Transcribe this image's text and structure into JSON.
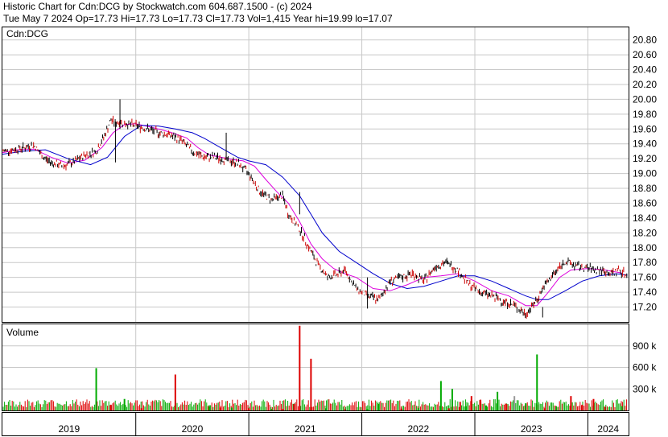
{
  "header": {
    "line1": "Historic Chart for Cdn:DCG by Stockwatch.com 604.687.1500 - (c) 2024",
    "line2": "Tue May  7 2024   Op=17.73  Hi=17.73  Lo=17.73  Cl=17.73  Vol=1,415   Year hi=19.99  lo=17.07"
  },
  "chart_data": [
    {
      "type": "line",
      "panel": "price",
      "panel_label": "Cdn:DCG",
      "x_tick_labels": [
        "2019",
        "2020",
        "2021",
        "2022",
        "2023",
        "2024"
      ],
      "y_tick_labels": [
        "17.20",
        "17.40",
        "17.60",
        "17.80",
        "18.00",
        "18.20",
        "18.40",
        "18.60",
        "18.80",
        "19.00",
        "19.20",
        "19.40",
        "19.60",
        "19.80",
        "20.00",
        "20.20",
        "20.40",
        "20.60",
        "20.80"
      ],
      "ylim": [
        17.0,
        20.97
      ],
      "grid": true,
      "colors": {
        "price_bars": "#000000",
        "down_ticks": "#cc0000",
        "ma_short": "#dd00dd",
        "ma_long": "#0000cc"
      },
      "series": [
        {
          "kind": "price",
          "x": [
            2018.82,
            2018.92,
            2019.02,
            2019.1,
            2019.18,
            2019.25,
            2019.35,
            2019.45,
            2019.55,
            2019.65,
            2019.72,
            2019.78,
            2019.82,
            2019.86,
            2019.9,
            2019.95,
            2020.0,
            2020.1,
            2020.2,
            2020.3,
            2020.4,
            2020.5,
            2020.6,
            2020.7,
            2020.8,
            2020.85,
            2020.9,
            2021.0,
            2021.1,
            2021.2,
            2021.3,
            2021.35,
            2021.45,
            2021.55,
            2021.6,
            2021.7,
            2021.8,
            2021.85,
            2021.95,
            2022.05,
            2022.15,
            2022.25,
            2022.35,
            2022.45,
            2022.55,
            2022.65,
            2022.75,
            2022.85,
            2022.95,
            2023.05,
            2023.15,
            2023.25,
            2023.35,
            2023.45,
            2023.55,
            2023.6,
            2023.7,
            2023.8,
            2023.9,
            2024.0,
            2024.1,
            2024.2,
            2024.28,
            2024.35
          ],
          "values": [
            19.3,
            19.32,
            19.35,
            19.38,
            19.22,
            19.15,
            19.1,
            19.15,
            19.25,
            19.3,
            19.5,
            19.72,
            19.68,
            19.7,
            19.68,
            19.66,
            19.65,
            19.6,
            19.55,
            19.52,
            19.45,
            19.3,
            19.22,
            19.22,
            19.18,
            19.16,
            19.14,
            19.0,
            18.75,
            18.65,
            18.7,
            18.45,
            18.25,
            17.95,
            17.8,
            17.6,
            17.65,
            17.7,
            17.45,
            17.35,
            17.3,
            17.55,
            17.6,
            17.65,
            17.55,
            17.75,
            17.8,
            17.7,
            17.5,
            17.4,
            17.35,
            17.28,
            17.22,
            17.1,
            17.3,
            17.45,
            17.65,
            17.82,
            17.75,
            17.72,
            17.7,
            17.65,
            17.7,
            17.62
          ]
        },
        {
          "kind": "ma_short",
          "x": [
            2018.82,
            2018.95,
            2019.1,
            2019.25,
            2019.4,
            2019.55,
            2019.7,
            2019.8,
            2019.9,
            2020.0,
            2020.15,
            2020.3,
            2020.45,
            2020.55,
            2020.65,
            2020.75,
            2020.85,
            2020.95,
            2021.05,
            2021.15,
            2021.25,
            2021.35,
            2021.45,
            2021.55,
            2021.65,
            2021.75,
            2021.85,
            2021.95,
            2022.1,
            2022.25,
            2022.4,
            2022.55,
            2022.7,
            2022.85,
            2023.0,
            2023.15,
            2023.3,
            2023.45,
            2023.55,
            2023.65,
            2023.75,
            2023.85,
            2024.0,
            2024.15,
            2024.3
          ],
          "values": [
            19.28,
            19.32,
            19.33,
            19.22,
            19.14,
            19.18,
            19.35,
            19.55,
            19.66,
            19.67,
            19.62,
            19.56,
            19.48,
            19.35,
            19.25,
            19.22,
            19.19,
            19.17,
            19.1,
            18.92,
            18.75,
            18.6,
            18.35,
            18.05,
            17.85,
            17.72,
            17.65,
            17.6,
            17.45,
            17.42,
            17.5,
            17.6,
            17.62,
            17.65,
            17.55,
            17.42,
            17.35,
            17.22,
            17.22,
            17.4,
            17.6,
            17.7,
            17.72,
            17.7,
            17.66
          ]
        },
        {
          "kind": "ma_long",
          "x": [
            2018.82,
            2019.0,
            2019.2,
            2019.4,
            2019.6,
            2019.75,
            2019.9,
            2020.05,
            2020.2,
            2020.35,
            2020.5,
            2020.6,
            2020.75,
            2020.9,
            2021.0,
            2021.15,
            2021.3,
            2021.45,
            2021.55,
            2021.65,
            2021.8,
            2021.95,
            2022.1,
            2022.25,
            2022.4,
            2022.55,
            2022.7,
            2022.85,
            2023.0,
            2023.15,
            2023.3,
            2023.45,
            2023.55,
            2023.65,
            2023.8,
            2023.95,
            2024.1,
            2024.25,
            2024.35
          ],
          "values": [
            19.26,
            19.3,
            19.32,
            19.2,
            19.12,
            19.22,
            19.5,
            19.65,
            19.64,
            19.6,
            19.55,
            19.48,
            19.35,
            19.22,
            19.17,
            19.12,
            18.95,
            18.7,
            18.45,
            18.2,
            17.95,
            17.8,
            17.65,
            17.52,
            17.45,
            17.48,
            17.55,
            17.62,
            17.62,
            17.55,
            17.45,
            17.35,
            17.3,
            17.3,
            17.42,
            17.55,
            17.62,
            17.65,
            17.63
          ]
        }
      ]
    },
    {
      "type": "bar",
      "panel": "volume",
      "panel_label": "Volume",
      "y_tick_labels": [
        "300 k",
        "600 k",
        "900 k"
      ],
      "ylim": [
        0,
        1200
      ],
      "y_unit": "k",
      "colors": {
        "up": "#00aa00",
        "down": "#dd0000",
        "neutral": "#999999"
      },
      "x": [
        2019.65,
        2019.78,
        2019.9,
        2020.05,
        2020.35,
        2020.65,
        2020.75,
        2020.85,
        2021.0,
        2021.2,
        2021.3,
        2021.4,
        2021.45,
        2021.55,
        2021.68,
        2021.85,
        2022.05,
        2022.15,
        2022.35,
        2022.5,
        2022.7,
        2022.77,
        2022.8,
        2022.87,
        2022.92,
        2022.97,
        2023.05,
        2023.1,
        2023.2,
        2023.28,
        2023.35,
        2023.45,
        2023.55,
        2023.62,
        2023.72,
        2023.85,
        2023.95,
        2024.05,
        2024.15,
        2024.3
      ],
      "values": [
        590,
        80,
        160,
        30,
        500,
        60,
        40,
        40,
        30,
        20,
        20,
        90,
        1180,
        720,
        30,
        20,
        20,
        90,
        25,
        30,
        410,
        30,
        300,
        120,
        60,
        200,
        150,
        70,
        260,
        90,
        200,
        100,
        780,
        30,
        60,
        200,
        80,
        160,
        50,
        60
      ],
      "colors_per_bar": [
        "up",
        "down",
        "up",
        "down",
        "down",
        "up",
        "down",
        "up",
        "down",
        "up",
        "down",
        "down",
        "down",
        "down",
        "up",
        "down",
        "up",
        "up",
        "down",
        "up",
        "up",
        "red",
        "up",
        "down",
        "up",
        "red",
        "down",
        "up",
        "up",
        "down",
        "neutral",
        "up",
        "up",
        "down",
        "up",
        "down",
        "down",
        "red",
        "down",
        "up"
      ]
    }
  ]
}
